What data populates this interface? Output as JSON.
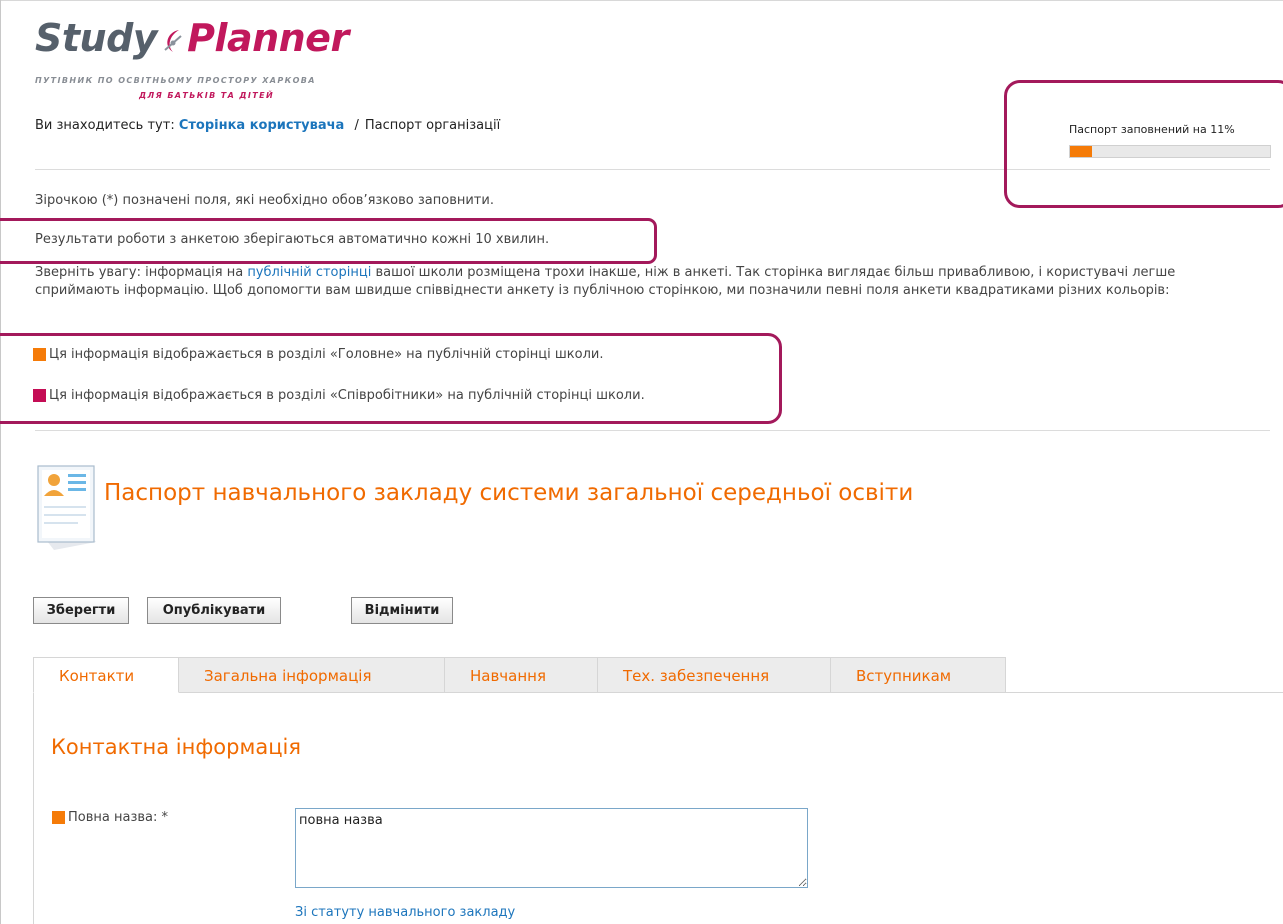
{
  "colors": {
    "accent_orange": "#f06a00",
    "brand_magenta": "#c1185c",
    "link_blue": "#1c75bc",
    "legend_orange": "#f57b08",
    "legend_magenta": "#c40d55",
    "annotation": "#a3195b"
  },
  "logo": {
    "word1": "Study",
    "word2": "Planner",
    "tagline1": "ПУТІВНИК ПО ОСВІТНЬОМУ ПРОСТОРУ ХАРКОВА",
    "tagline2": "ДЛЯ БАТЬКІВ ТА ДІТЕЙ"
  },
  "breadcrumb": {
    "prefix": "Ви знаходитесь тут:",
    "link": "Сторінка користувача",
    "separator": "/",
    "current": "Паспорт організації"
  },
  "progress": {
    "label": "Паспорт заповнений на 11%",
    "percent": 11
  },
  "notes": {
    "required": "Зірочкою (*) позначені поля, які необхідно обов’язково заповнити.",
    "autosave": "Результати роботи з анкетою зберігаються автоматично кожні 10 хвилин.",
    "para_before_link": "Зверніть увагу: інформація на ",
    "para_link": "публічній сторінці",
    "para_after_link": " вашої школи розміщена трохи інакше, ніж в анкеті. Так сторінка виглядає більш привабливою, і користувачі легше сприймають інформацію. Щоб допомогти вам швидше співвіднести анкету із публічною сторінкою, ми позначили певні поля анкети квадратиками різних кольорів:"
  },
  "legend": [
    {
      "color": "#f57b08",
      "text": "Ця інформація відображається в розділі «Головне» на публічній сторінці школи."
    },
    {
      "color": "#c40d55",
      "text": "Ця інформація відображається в розділі «Співробітники» на публічній сторінці школи."
    }
  ],
  "page_title": "Паспорт навчального закладу системи загальної середньої освіти",
  "icons": {
    "document": "document-person-icon",
    "logo_mark": "compass-star-icon",
    "square": "color-square-icon"
  },
  "buttons": {
    "save": "Зберегти",
    "publish": "Опублікувати",
    "cancel": "Відмінити"
  },
  "tabs": [
    {
      "label": "Контакти",
      "active": true
    },
    {
      "label": "Загальна інформація",
      "active": false
    },
    {
      "label": "Навчання",
      "active": false
    },
    {
      "label": "Тех. забезпечення",
      "active": false
    },
    {
      "label": "Вступникам",
      "active": false
    }
  ],
  "section": {
    "title": "Контактна інформація",
    "full_name_label": "Повна назва: *",
    "full_name_value": "повна назва",
    "full_name_hint": "Зі статуту навчального закладу"
  }
}
